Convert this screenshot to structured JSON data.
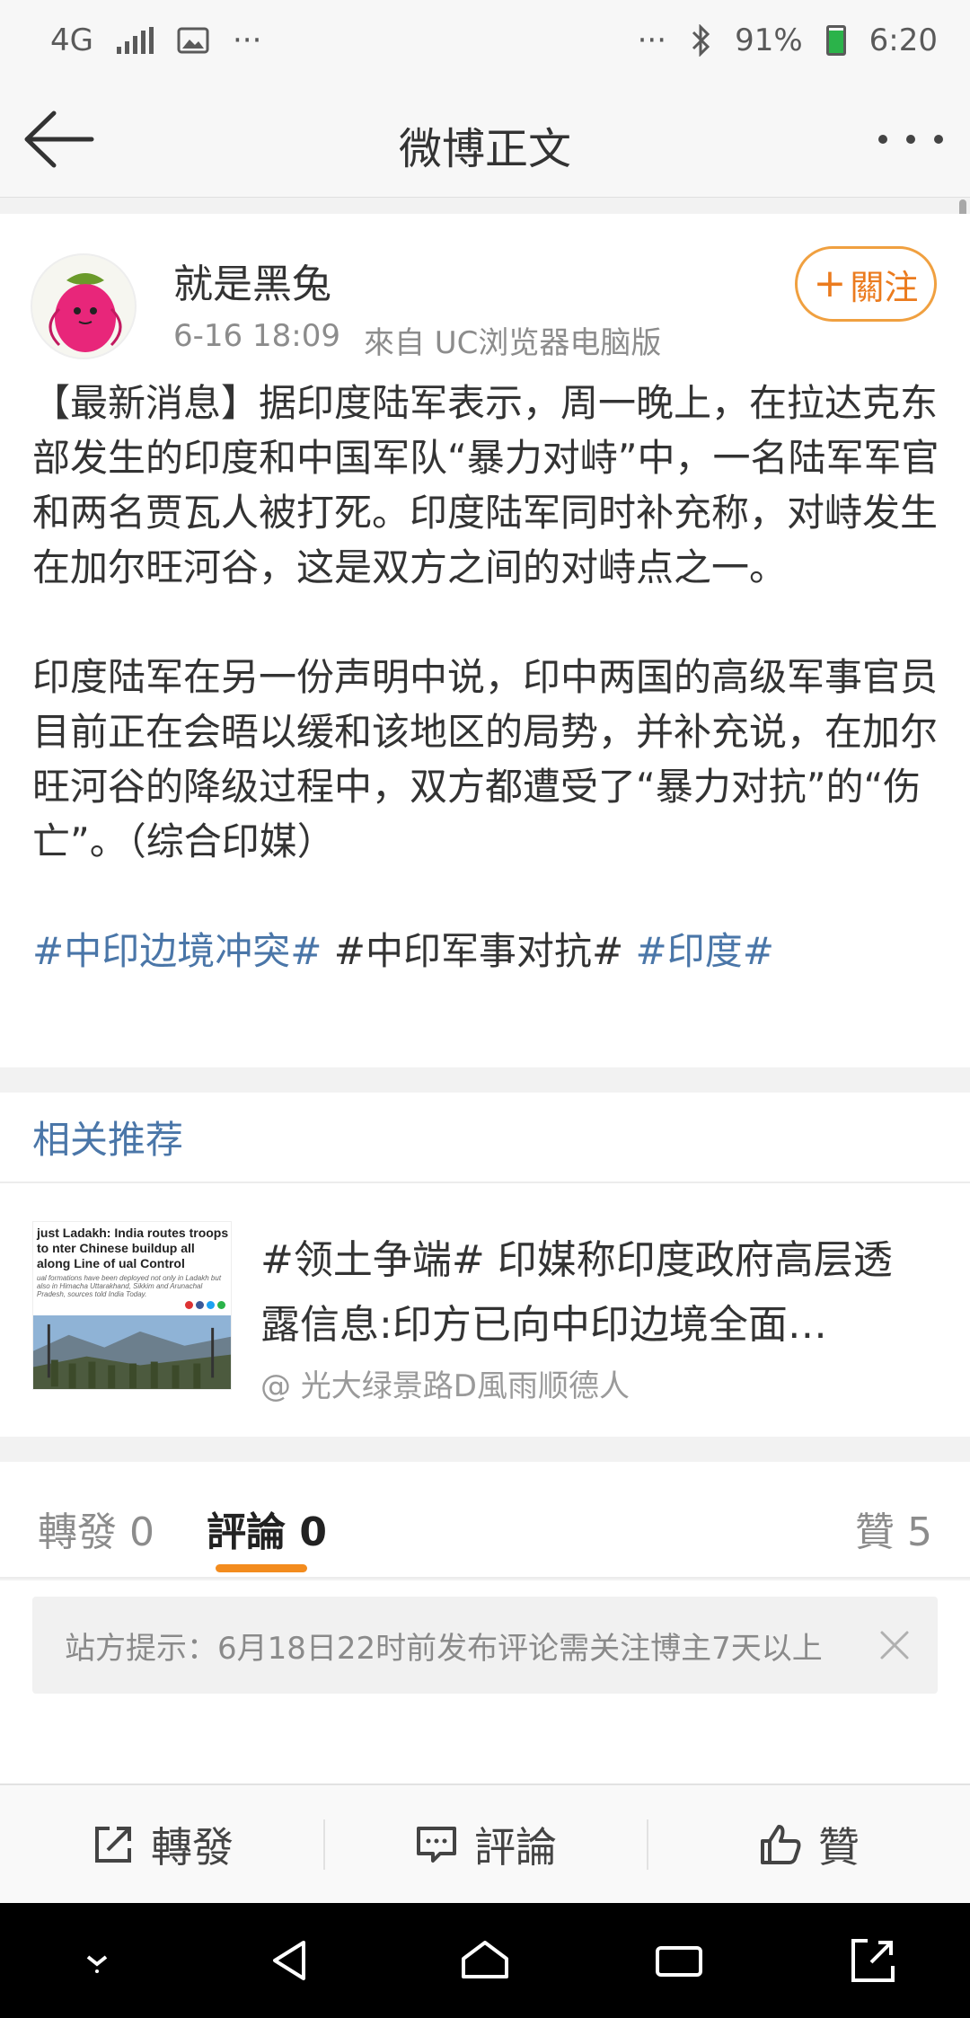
{
  "status_bar": {
    "network": "4G",
    "dots_left": "···",
    "dots_right": "···",
    "bluetooth": "✱",
    "battery_percent": "91%",
    "battery_level": 0.91,
    "time": "6:20"
  },
  "header": {
    "title": "微博正文"
  },
  "post": {
    "author": "就是黑兔",
    "time": "6-16 18:09",
    "source": "來自 UC浏览器电脑版",
    "follow_label": "關注",
    "paragraph1": "【最新消息】据印度陆军表示，周一晚上，在拉达克东部发生的印度和中国军队“暴力对峙”中，一名陆军军官和两名贾瓦人被打死。印度陆军同时补充称，对峙发生在加尔旺河谷，这是双方之间的对峙点之一。",
    "paragraph2": "印度陆军在另一份声明中说，印中两国的高级军事官员目前正在会晤以缓和该地区的局势，并补充说，在加尔旺河谷的降级过程中，双方都遭受了“暴力对抗”的“伤亡”。（综合印媒）",
    "tags": [
      {
        "text": "#中印边境冲突#",
        "link": true
      },
      {
        "text": "#中印军事对抗#",
        "link": false
      },
      {
        "text": "#印度#",
        "link": true
      }
    ]
  },
  "related": {
    "header": "相关推荐",
    "item": {
      "title": "#领土争端#  印媒称印度政府高层透露信息:印方已向中印边境全面…",
      "source": "@ 光大绿景路D風雨顺德人",
      "thumb_headline": "just Ladakh: India routes troops to nter Chinese buildup all along Line of ual Control",
      "thumb_subtext": "ual formations have been deployed not only in Ladakh but also in Himacha Uttarakhand, Sikkim and Arunachal Pradesh, sources told India Today."
    }
  },
  "tabs": {
    "repost": "轉發 0",
    "comment": "評論 0",
    "like": "贊 5"
  },
  "notice": {
    "text": "站方提示：6月18日22时前发布评论需关注博主7天以上"
  },
  "actions": {
    "repost": "轉發",
    "comment": "評論",
    "like": "贊"
  },
  "colors": {
    "link": "#4a76a8",
    "accent": "#f38c1e",
    "follow_border": "#f0a040"
  }
}
